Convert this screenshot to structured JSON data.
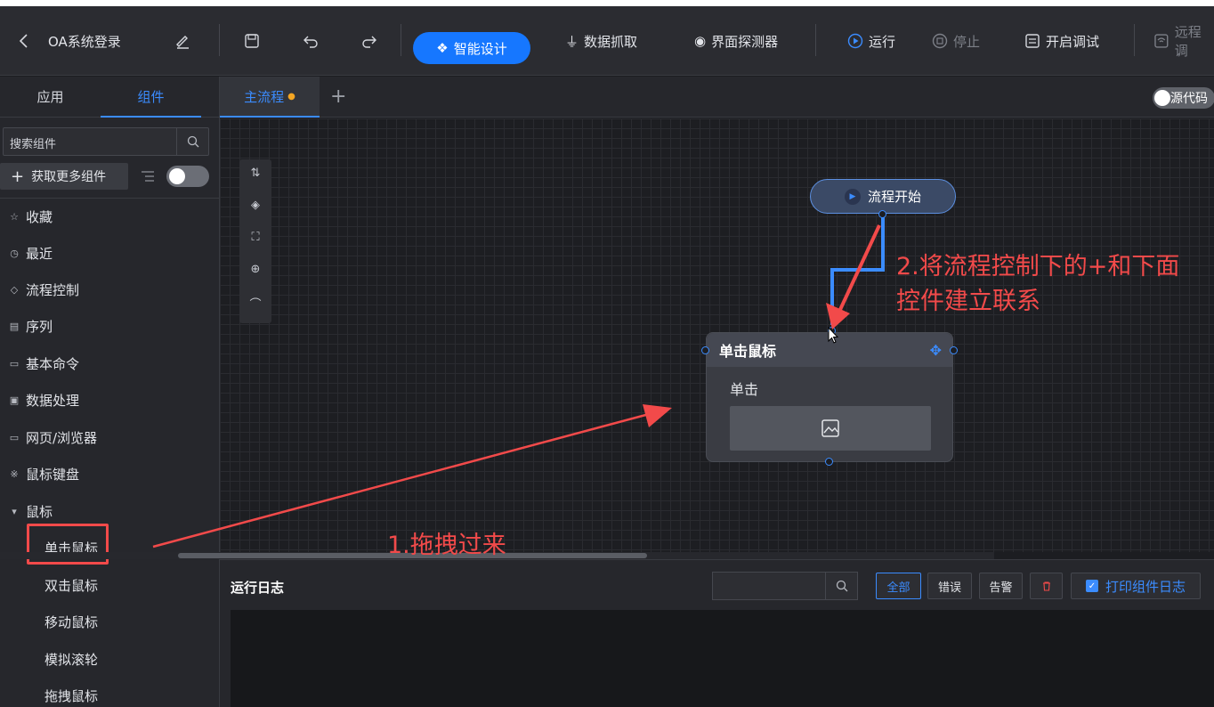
{
  "toolbar": {
    "title": "OA系统登录",
    "smart_design": "智能设计",
    "data_capture": "数据抓取",
    "ui_detector": "界面探测器",
    "run": "运行",
    "stop": "停止",
    "debug": "开启调试",
    "remote": "远程调"
  },
  "left_panel": {
    "tabs": [
      "应用",
      "组件"
    ],
    "search_placeholder": "搜索组件",
    "more_components": "获取更多组件",
    "categories": [
      "收藏",
      "最近",
      "流程控制",
      "序列",
      "基本命令",
      "数据处理",
      "网页/浏览器",
      "鼠标键盘",
      "鼠标"
    ],
    "mouse_items": [
      "单击鼠标",
      "双击鼠标",
      "移动鼠标",
      "模拟滚轮",
      "拖拽鼠标"
    ]
  },
  "editor": {
    "tab_main": "主流程",
    "add_tab": "+",
    "source_code": "源代码"
  },
  "canvas": {
    "start_node": "流程开始",
    "node_title": "单击鼠标",
    "node_subtitle": "单击"
  },
  "annotations": {
    "step1": "1.拖拽过来",
    "step2_line1": "2.将流程控制下的+和下面",
    "step2_line2": "控件建立联系"
  },
  "log": {
    "title": "运行日志",
    "filters": [
      "全部",
      "错误",
      "告警"
    ],
    "print_log": "打印组件日志"
  },
  "colors": {
    "accent": "#1677ff",
    "annotation": "#f24a4a"
  }
}
